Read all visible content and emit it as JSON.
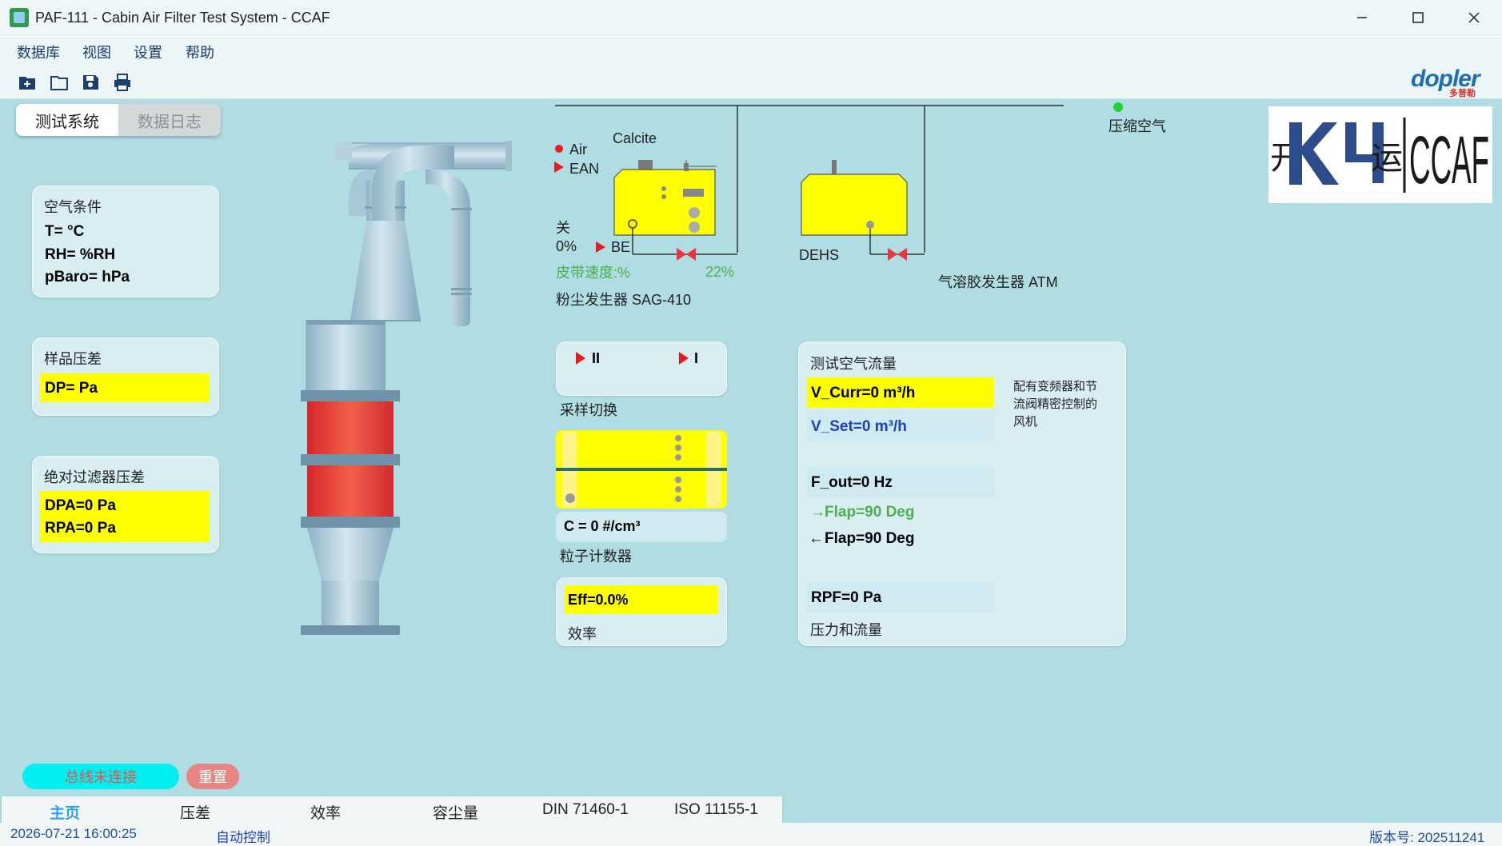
{
  "window": {
    "title": "PAF-111 - Cabin Air Filter Test System - CCAF"
  },
  "menu": [
    "数据库",
    "视图",
    "设置",
    "帮助"
  ],
  "toolbar": {
    "icons": [
      "new-icon",
      "open-folder-icon",
      "save-icon",
      "print-icon"
    ]
  },
  "brand": {
    "logo_text": "dopler",
    "logo_sub": "多普勒",
    "customer_logo": "KY CCAF"
  },
  "tabs": [
    {
      "label": "测试系统",
      "active": true
    },
    {
      "label": "数据日志",
      "active": false
    }
  ],
  "air_conditions": {
    "title": "空气条件",
    "t": "T= °C",
    "rh": "RH= %RH",
    "pbaro": "pBaro= hPa"
  },
  "sample_dp": {
    "title": "样品压差",
    "dp": "DP= Pa"
  },
  "abs_filter": {
    "title": "绝对过滤器压差",
    "dpa": "DPA=0 Pa",
    "rpa": "RPA=0 Pa"
  },
  "dust_gen": {
    "air": "Air",
    "ean": "EAN",
    "calcite": "Calcite",
    "state": "关",
    "percent": "0%",
    "be": "BE",
    "belt_speed": "皮带速度:%",
    "valve_pct": "22%",
    "name": "粉尘发生器 SAG-410"
  },
  "aerosol": {
    "dehs": "DEHS",
    "name": "气溶胶发生器 ATM",
    "compressed_air": "压缩空气"
  },
  "sampling": {
    "ii": "II",
    "i": "I",
    "label": "采样切换"
  },
  "counter": {
    "conc": "C = 0 #/cm³",
    "label": "粒子计数器"
  },
  "efficiency": {
    "value": "Eff=0.0%",
    "label": "效率"
  },
  "airflow": {
    "title": "测试空气流量",
    "v_curr": "V_Curr=0 m³/h",
    "v_set": "V_Set=0 m³/h",
    "note": "配有变频器和节流阀精密控制的风机",
    "f_out": "F_out=0 Hz",
    "flap_in": "Flap=90 Deg",
    "flap_out": "Flap=90 Deg",
    "rpf": "RPF=0 Pa",
    "footer": "压力和流量"
  },
  "bus": {
    "status": "总线未连接",
    "reset": "重置"
  },
  "bottom_tabs": [
    "主页",
    "压差",
    "效率",
    "容尘量",
    "DIN 71460-1",
    "ISO 11155-1"
  ],
  "status": {
    "datetime": "2026-07-21 16:00:25",
    "mode": "自动控制",
    "version": "版本号: 202511241"
  },
  "colors": {
    "accent_yellow": "#ffff00",
    "ok_green": "#4caf50",
    "link_blue": "#2040c0",
    "cyclone": "#a6c6d6",
    "filter_red": "#e0383a"
  }
}
